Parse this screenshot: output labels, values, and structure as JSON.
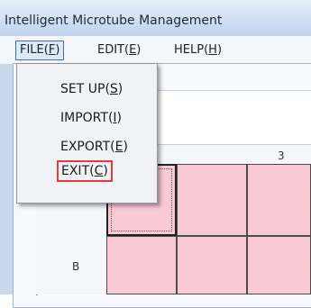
{
  "window": {
    "title": "Intelligent Microtube Management"
  },
  "menubar": {
    "file": {
      "label": "FILE",
      "mnemonic": "F"
    },
    "edit": {
      "label": "EDIT",
      "mnemonic": "E"
    },
    "help": {
      "label": "HELP",
      "mnemonic": "H"
    }
  },
  "file_menu": {
    "items": [
      {
        "label": "SET UP",
        "mnemonic": "S"
      },
      {
        "label": "IMPORT",
        "mnemonic": "I"
      },
      {
        "label": "EXPORT",
        "mnemonic": "E"
      },
      {
        "label": "EXIT",
        "mnemonic": "C"
      }
    ]
  },
  "grid": {
    "visible_column": "3",
    "visible_rows": [
      "B"
    ],
    "cell_color": "#f9c9d6"
  }
}
